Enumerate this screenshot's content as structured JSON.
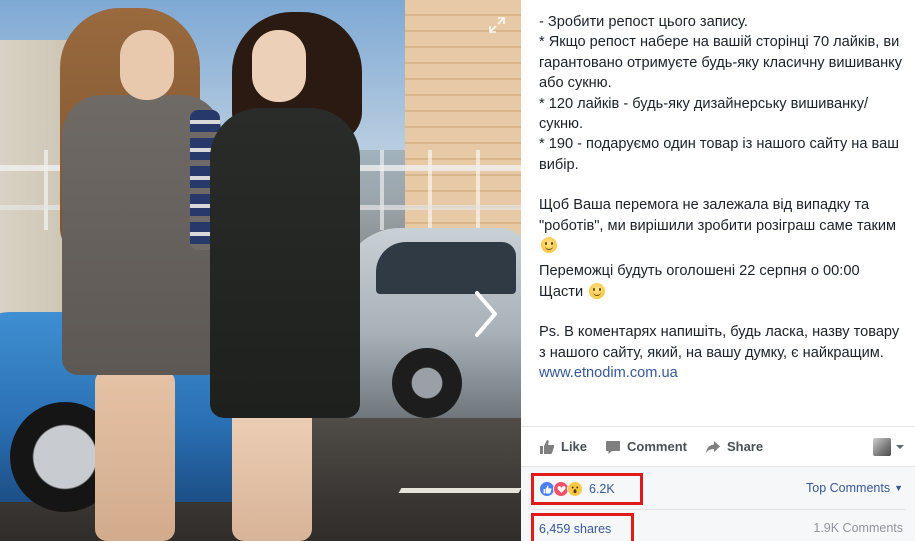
{
  "post": {
    "lines": [
      "- Зробити репост цього запису.",
      "* Якщо репост набере на вашій сторінці 70 лайків, ви гарантовано отримуєте будь-яку класичну вишиванку або сукню.",
      "* 120 лайків - будь-яку дизайнерську вишиванку/ сукню.",
      "* 190 - подаруємо один товар із нашого сайту на ваш вибір."
    ],
    "para_luck": "Щоб Ваша перемога не залежала від випадку та \"роботів\", ми вирішили зробити розіграш саме таким",
    "para_winners": "Переможці будуть оголошені 22 серпня о 00:00",
    "para_happy": "Щасти",
    "para_ps": "Ps. В коментарях напишіть, будь ласка, назву товару з нашого сайту, який, на вашу думку, є найкращим.",
    "link": "www.etnodim.com.ua"
  },
  "actions": {
    "like": "Like",
    "comment": "Comment",
    "share": "Share"
  },
  "stats": {
    "reactions_count": "6.2K",
    "top_comments": "Top Comments",
    "shares": "6,459 shares",
    "comments": "1.9K Comments"
  },
  "colors": {
    "link": "#365899",
    "highlight_border": "#e01919",
    "like_reaction": "#4c80f1",
    "love_reaction": "#f25268",
    "wow_reaction": "#f7c948"
  },
  "icons": {
    "expand": "expand-icon",
    "next": "chevron-right-icon",
    "like": "thumbs-up-icon",
    "comment": "comment-bubble-icon",
    "share": "share-arrow-icon",
    "smiley": "smiley-emoji-icon"
  }
}
